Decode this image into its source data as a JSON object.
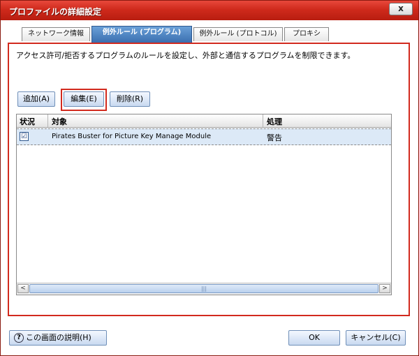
{
  "window": {
    "title": "プロファイルの詳細設定",
    "close_label": "x"
  },
  "tabs": [
    {
      "label": "ネットワーク情報",
      "active": false
    },
    {
      "label": "例外ルール (プログラム)",
      "active": true
    },
    {
      "label": "例外ルール (プロトコル)",
      "active": false
    },
    {
      "label": "プロキシ",
      "active": false
    }
  ],
  "panel": {
    "description": "アクセス許可/拒否するプログラムのルールを設定し、外部と通信するプログラムを制限できます。",
    "buttons": {
      "add": "追加(A)",
      "edit": "編集(E)",
      "delete": "削除(R)"
    }
  },
  "table": {
    "columns": [
      "状況",
      "対象",
      "処理"
    ],
    "rows": [
      {
        "checked": "☑",
        "target": "Pirates Buster for Picture Key Manage Module",
        "action": "警告"
      }
    ],
    "scroll": {
      "left": "<",
      "right": ">",
      "grip": "|||"
    }
  },
  "footer": {
    "help": "この画面の説明(H)",
    "help_icon": "?",
    "ok": "OK",
    "cancel": "キャンセル(C)"
  }
}
